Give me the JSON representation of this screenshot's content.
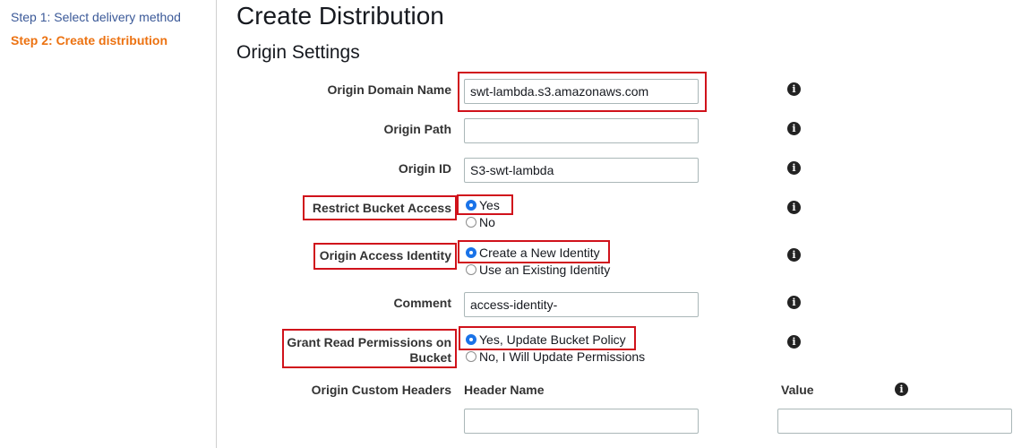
{
  "sidebar": {
    "steps": [
      {
        "label": "Step 1: Select delivery method",
        "active": false
      },
      {
        "label": "Step 2: Create distribution",
        "active": true
      }
    ]
  },
  "header": {
    "title": "Create Distribution",
    "section": "Origin Settings"
  },
  "form": {
    "origin_domain_name": {
      "label": "Origin Domain Name",
      "value": "swt-lambda.s3.amazonaws.com"
    },
    "origin_path": {
      "label": "Origin Path",
      "value": ""
    },
    "origin_id": {
      "label": "Origin ID",
      "value": "S3-swt-lambda"
    },
    "restrict_bucket_access": {
      "label": "Restrict Bucket Access",
      "options": [
        {
          "label": "Yes",
          "selected": true
        },
        {
          "label": "No",
          "selected": false
        }
      ]
    },
    "origin_access_identity": {
      "label": "Origin Access Identity",
      "options": [
        {
          "label": "Create a New Identity",
          "selected": true
        },
        {
          "label": "Use an Existing Identity",
          "selected": false
        }
      ]
    },
    "comment": {
      "label": "Comment",
      "value": "access-identity-"
    },
    "grant_read_permissions": {
      "label_line1": "Grant Read Permissions on",
      "label_line2": "Bucket",
      "options": [
        {
          "label": "Yes, Update Bucket Policy",
          "selected": true
        },
        {
          "label": "No, I Will Update Permissions",
          "selected": false
        }
      ]
    },
    "origin_custom_headers": {
      "label": "Origin Custom Headers",
      "header_name_label": "Header Name",
      "value_label": "Value",
      "header_name_value": "",
      "value_value": ""
    }
  },
  "icons": {
    "info": "i"
  },
  "colors": {
    "highlight": "#d0121b",
    "step_active": "#ec7211",
    "step_link": "#3b5998",
    "radio_selected": "#1a73e8"
  }
}
